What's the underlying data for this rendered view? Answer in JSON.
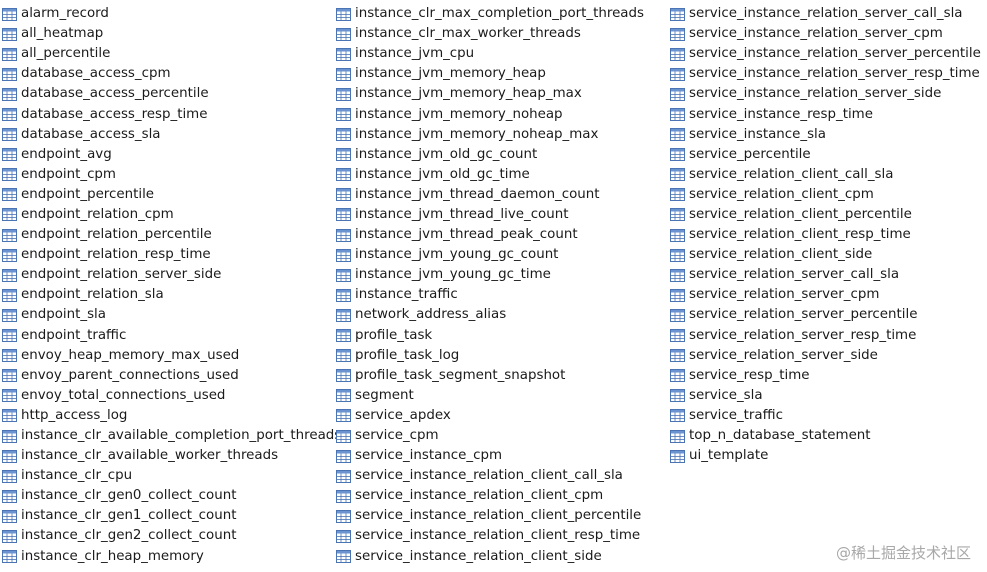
{
  "columns": [
    {
      "items": [
        "alarm_record",
        "all_heatmap",
        "all_percentile",
        "database_access_cpm",
        "database_access_percentile",
        "database_access_resp_time",
        "database_access_sla",
        "endpoint_avg",
        "endpoint_cpm",
        "endpoint_percentile",
        "endpoint_relation_cpm",
        "endpoint_relation_percentile",
        "endpoint_relation_resp_time",
        "endpoint_relation_server_side",
        "endpoint_relation_sla",
        "endpoint_sla",
        "endpoint_traffic",
        "envoy_heap_memory_max_used",
        "envoy_parent_connections_used",
        "envoy_total_connections_used",
        "http_access_log",
        "instance_clr_available_completion_port_threads",
        "instance_clr_available_worker_threads",
        "instance_clr_cpu",
        "instance_clr_gen0_collect_count",
        "instance_clr_gen1_collect_count",
        "instance_clr_gen2_collect_count",
        "instance_clr_heap_memory"
      ]
    },
    {
      "items": [
        "instance_clr_max_completion_port_threads",
        "instance_clr_max_worker_threads",
        "instance_jvm_cpu",
        "instance_jvm_memory_heap",
        "instance_jvm_memory_heap_max",
        "instance_jvm_memory_noheap",
        "instance_jvm_memory_noheap_max",
        "instance_jvm_old_gc_count",
        "instance_jvm_old_gc_time",
        "instance_jvm_thread_daemon_count",
        "instance_jvm_thread_live_count",
        "instance_jvm_thread_peak_count",
        "instance_jvm_young_gc_count",
        "instance_jvm_young_gc_time",
        "instance_traffic",
        "network_address_alias",
        "profile_task",
        "profile_task_log",
        "profile_task_segment_snapshot",
        "segment",
        "service_apdex",
        "service_cpm",
        "service_instance_cpm",
        "service_instance_relation_client_call_sla",
        "service_instance_relation_client_cpm",
        "service_instance_relation_client_percentile",
        "service_instance_relation_client_resp_time",
        "service_instance_relation_client_side"
      ]
    },
    {
      "items": [
        "service_instance_relation_server_call_sla",
        "service_instance_relation_server_cpm",
        "service_instance_relation_server_percentile",
        "service_instance_relation_server_resp_time",
        "service_instance_relation_server_side",
        "service_instance_resp_time",
        "service_instance_sla",
        "service_percentile",
        "service_relation_client_call_sla",
        "service_relation_client_cpm",
        "service_relation_client_percentile",
        "service_relation_client_resp_time",
        "service_relation_client_side",
        "service_relation_server_call_sla",
        "service_relation_server_cpm",
        "service_relation_server_percentile",
        "service_relation_server_resp_time",
        "service_relation_server_side",
        "service_resp_time",
        "service_sla",
        "service_traffic",
        "top_n_database_statement",
        "ui_template"
      ]
    }
  ],
  "watermark": "@稀土掘金技术社区",
  "colors": {
    "icon_border": "#4a74b4",
    "icon_header": "#6a93cf",
    "icon_fill": "#ffffff",
    "text": "#1a1a1a",
    "watermark": "#a8a8a8"
  },
  "icons": {
    "item": "table-icon"
  }
}
